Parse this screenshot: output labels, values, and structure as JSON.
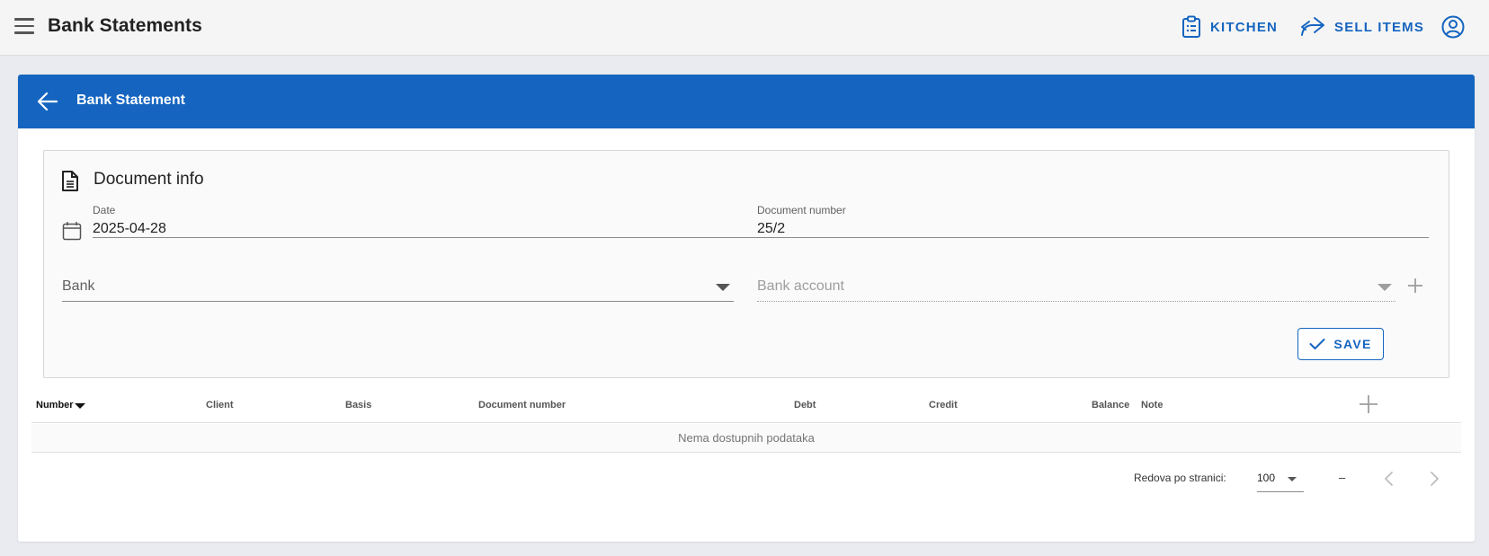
{
  "app": {
    "title": "Bank Statements",
    "actions": {
      "kitchen": "KITCHEN",
      "sell_items": "SELL ITEMS"
    }
  },
  "card": {
    "title": "Bank Statement",
    "panel_title": "Document info",
    "date": {
      "label": "Date",
      "value": "2025-04-28"
    },
    "document_number": {
      "label": "Document number",
      "value": "25/2"
    },
    "bank": {
      "placeholder": "Bank"
    },
    "bank_account": {
      "placeholder": "Bank account"
    },
    "save_label": "SAVE"
  },
  "table": {
    "columns": [
      "Number",
      "Client",
      "Basis",
      "Document number",
      "Debt",
      "Credit",
      "Balance",
      "Note"
    ],
    "sorted_column": "Number",
    "empty_text": "Nema dostupnih podataka"
  },
  "pagination": {
    "rows_label": "Redova po stranici:",
    "rows_value": "100",
    "range": "–"
  },
  "colors": {
    "primary": "#1565c0",
    "topbar": "#f5f5f5",
    "page_bg": "#e9ebf0"
  },
  "icons": [
    "menu-icon",
    "clipboard-list-icon",
    "share-arrow-icon",
    "account-circle-icon",
    "arrow-left-icon",
    "document-icon",
    "calendar-icon",
    "plus-icon",
    "check-icon",
    "chevron-left-icon",
    "chevron-right-icon"
  ]
}
